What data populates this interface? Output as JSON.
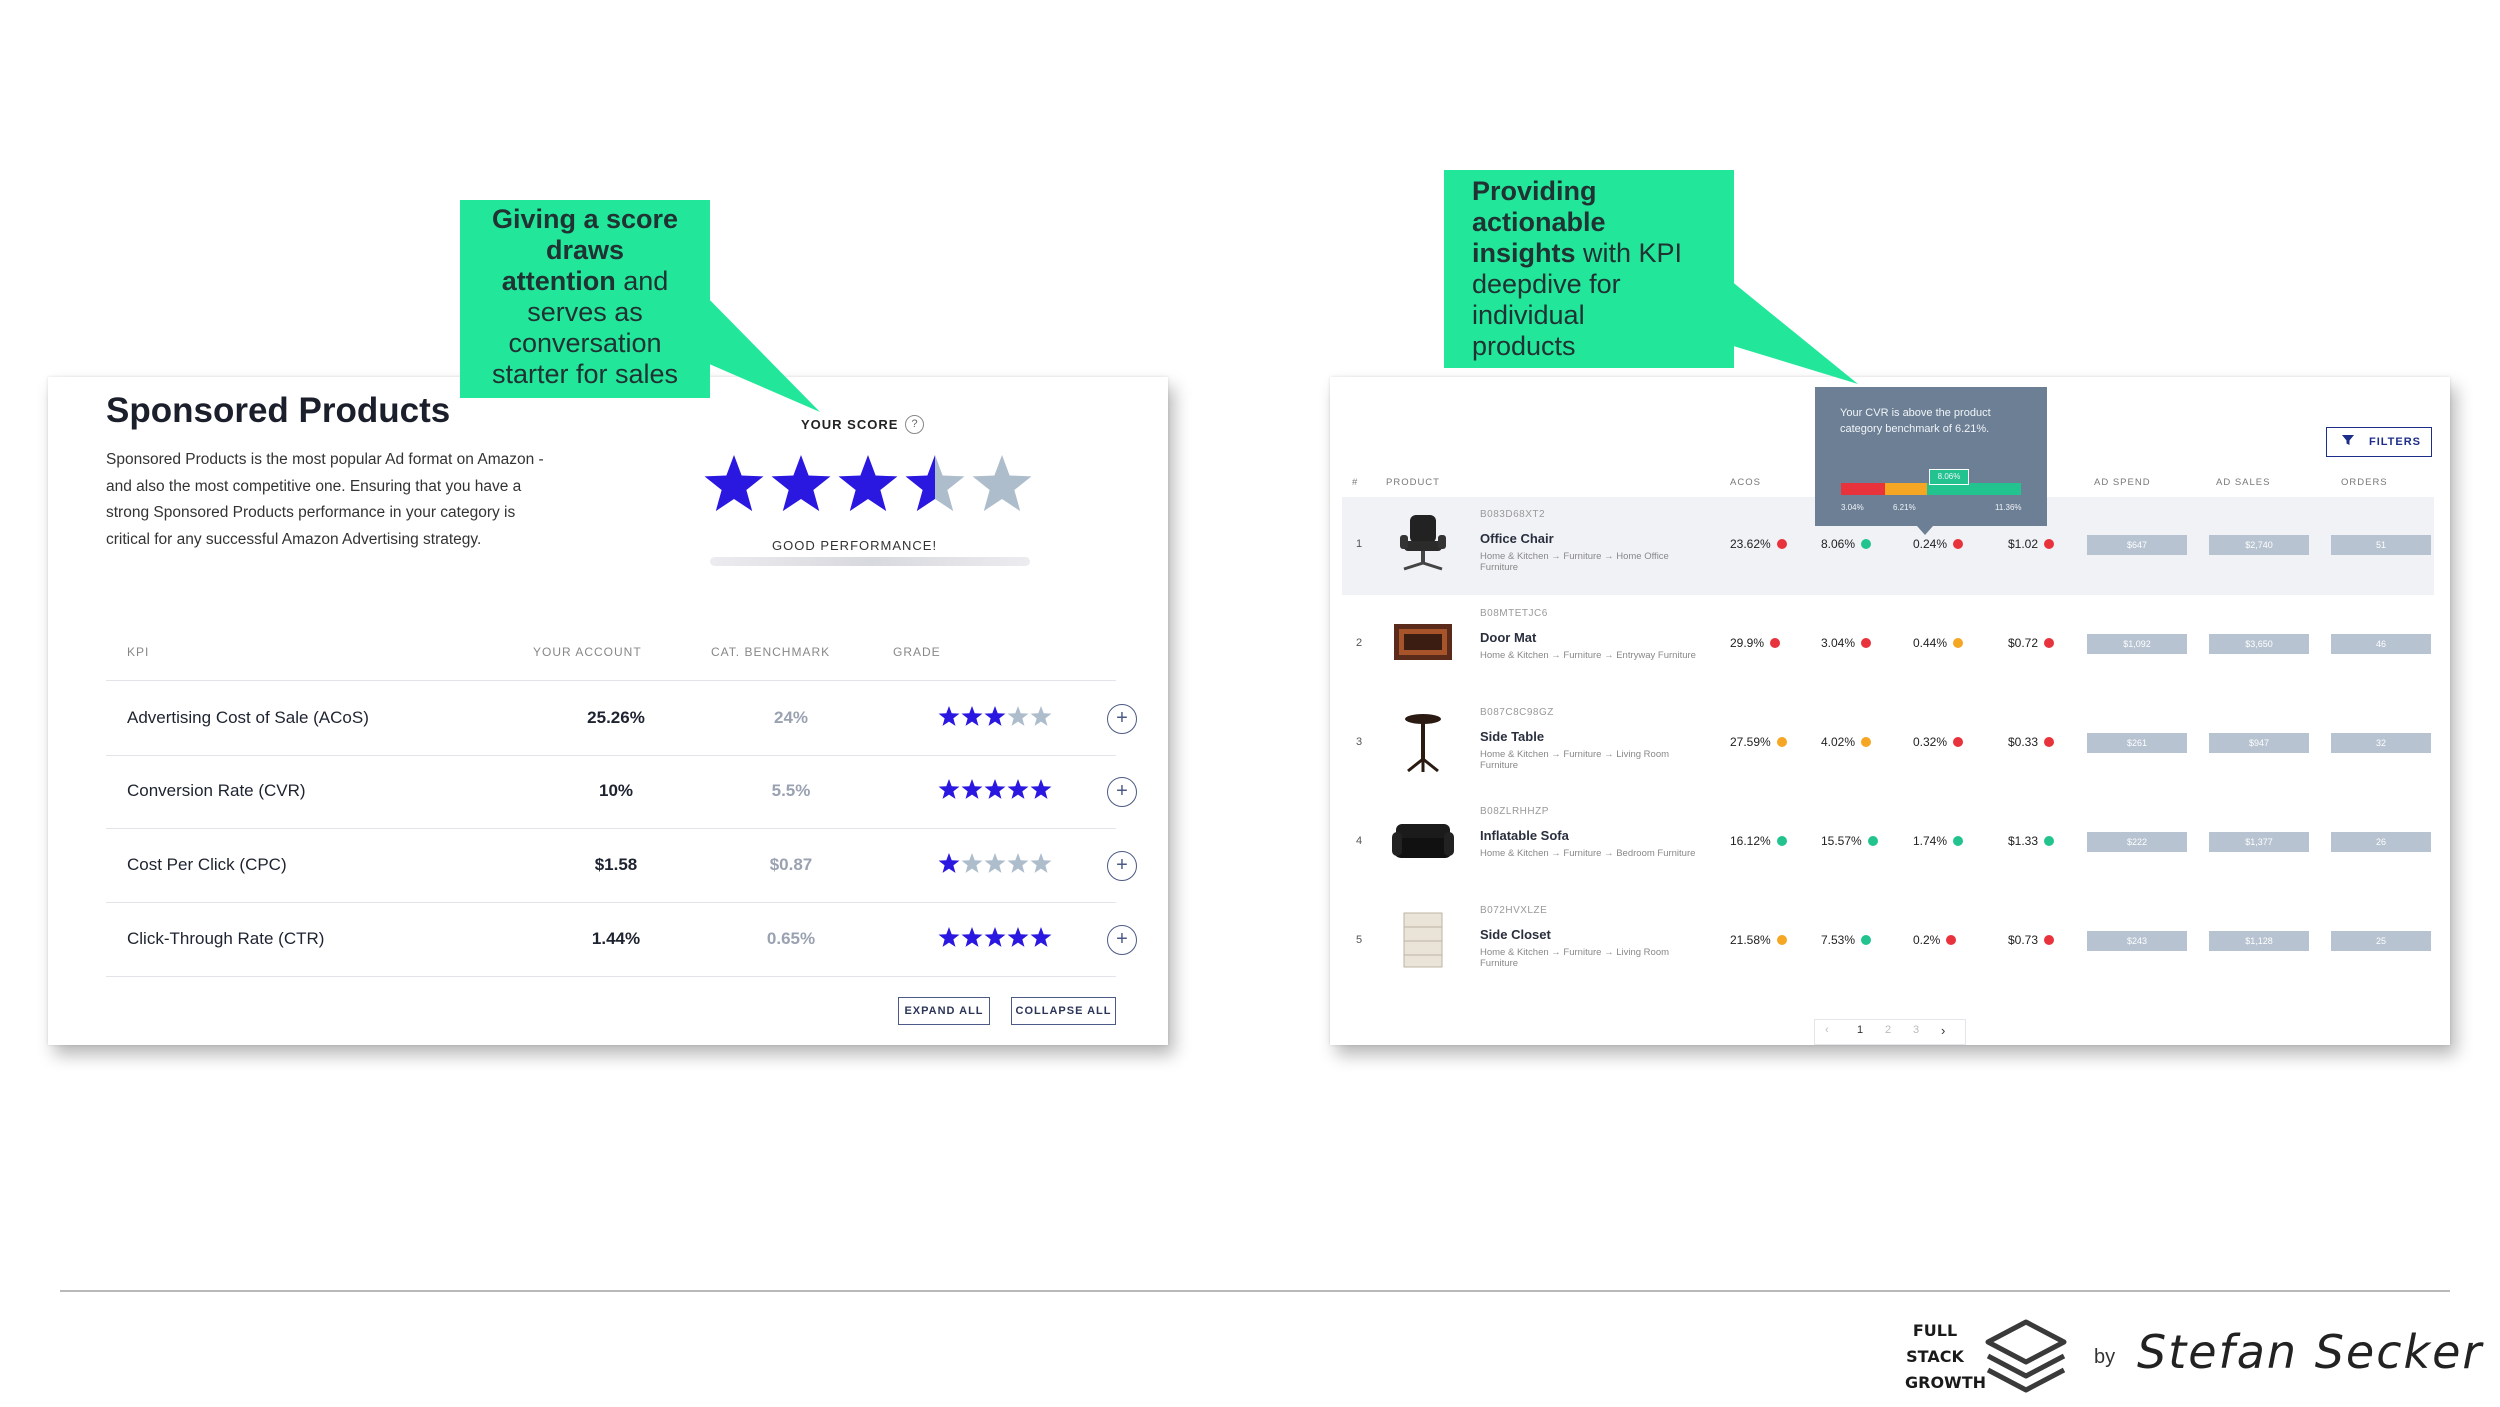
{
  "left_callout": {
    "line1": "Giving a score",
    "line2": "draws",
    "line3_bold": "attention",
    "line3_rest": " and",
    "line4": "serves as",
    "line5": "conversation",
    "line6": "starter for sales"
  },
  "right_callout": {
    "line1": "Providing",
    "line2": "actionable",
    "line3_bold": "insights",
    "line3_rest": " with KPI",
    "line4": "deepdive for",
    "line5": "individual",
    "line6": "products"
  },
  "sponsored": {
    "title": "Sponsored Products",
    "description": "Sponsored Products is the most popular Ad format on Amazon - and also the most competitive one. Ensuring that you have a strong Sponsored Products performance in your category is critical for any successful Amazon Advertising strategy.",
    "score_label": "YOUR SCORE",
    "help_glyph": "?",
    "score_stars": 3.5,
    "score_max": 5,
    "performance_label": "GOOD PERFORMANCE!",
    "columns": {
      "kpi": "KPI",
      "account": "YOUR ACCOUNT",
      "benchmark": "CAT. BENCHMARK",
      "grade": "GRADE"
    },
    "rows": [
      {
        "name": "Advertising Cost of Sale (ACoS)",
        "account": "25.26%",
        "benchmark": "24%",
        "grade": 3
      },
      {
        "name": "Conversion Rate (CVR)",
        "account": "10%",
        "benchmark": "5.5%",
        "grade": 5
      },
      {
        "name": "Cost Per Click (CPC)",
        "account": "$1.58",
        "benchmark": "$0.87",
        "grade": 1
      },
      {
        "name": "Click-Through Rate (CTR)",
        "account": "1.44%",
        "benchmark": "0.65%",
        "grade": 5
      }
    ],
    "plus_glyph": "+",
    "expand_label": "EXPAND ALL",
    "collapse_label": "COLLAPSE ALL"
  },
  "products_table": {
    "filters_label": "FILTERS",
    "columns": {
      "num": "#",
      "product": "PRODUCT",
      "acos": "ACOS",
      "ad_spend": "AD SPEND",
      "ad_sales": "AD SALES",
      "orders": "ORDERS"
    },
    "tooltip": {
      "text": "Your CVR is above the product category benchmark of 6.21%.",
      "current": "8.06%",
      "low": "3.04%",
      "mid": "6.21%",
      "high": "11.36%"
    },
    "rows": [
      {
        "n": "1",
        "asin": "B083D68XT2",
        "name": "Office Chair",
        "category": "Home & Kitchen → Furniture → Home Office Furniture",
        "m1": "23.62%",
        "m1c": "red",
        "m2": "8.06%",
        "m2c": "green",
        "m3": "0.24%",
        "m3c": "red",
        "m4": "$1.02",
        "m4c": "red",
        "spend": "$647",
        "sales": "$2,740",
        "orders": "51"
      },
      {
        "n": "2",
        "asin": "B08MTETJC6",
        "name": "Door Mat",
        "category": "Home & Kitchen → Furniture → Entryway Furniture",
        "m1": "29.9%",
        "m1c": "red",
        "m2": "3.04%",
        "m2c": "red",
        "m3": "0.44%",
        "m3c": "orange",
        "m4": "$0.72",
        "m4c": "red",
        "spend": "$1,092",
        "sales": "$3,650",
        "orders": "46"
      },
      {
        "n": "3",
        "asin": "B087C8C98GZ",
        "name": "Side Table",
        "category": "Home & Kitchen → Furniture → Living Room Furniture",
        "m1": "27.59%",
        "m1c": "orange",
        "m2": "4.02%",
        "m2c": "orange",
        "m3": "0.32%",
        "m3c": "red",
        "m4": "$0.33",
        "m4c": "red",
        "spend": "$261",
        "sales": "$947",
        "orders": "32"
      },
      {
        "n": "4",
        "asin": "B08ZLRHHZP",
        "name": "Inflatable Sofa",
        "category": "Home & Kitchen → Furniture → Bedroom Furniture",
        "m1": "16.12%",
        "m1c": "green",
        "m2": "15.57%",
        "m2c": "green",
        "m3": "1.74%",
        "m3c": "green",
        "m4": "$1.33",
        "m4c": "green",
        "spend": "$222",
        "sales": "$1,377",
        "orders": "26"
      },
      {
        "n": "5",
        "asin": "B072HVXLZE",
        "name": "Side Closet",
        "category": "Home & Kitchen → Furniture → Living Room Furniture",
        "m1": "21.58%",
        "m1c": "orange",
        "m2": "7.53%",
        "m2c": "green",
        "m3": "0.2%",
        "m3c": "red",
        "m4": "$0.73",
        "m4c": "red",
        "spend": "$243",
        "sales": "$1,128",
        "orders": "25"
      }
    ],
    "pager": {
      "prev": "‹",
      "p1": "1",
      "p2": "2",
      "p3": "3",
      "next": "›"
    }
  },
  "footer": {
    "brand_line1": "FULL",
    "brand_line2": "STACK",
    "brand_line3": "GROWTH",
    "by": "by",
    "author": "Stefan Secker"
  },
  "colors": {
    "accent": "#22e79b",
    "star": "#2a17e0",
    "star_empty": "#aebdcc",
    "red": "#e8323c",
    "orange": "#f5a623",
    "green": "#22c38e"
  }
}
